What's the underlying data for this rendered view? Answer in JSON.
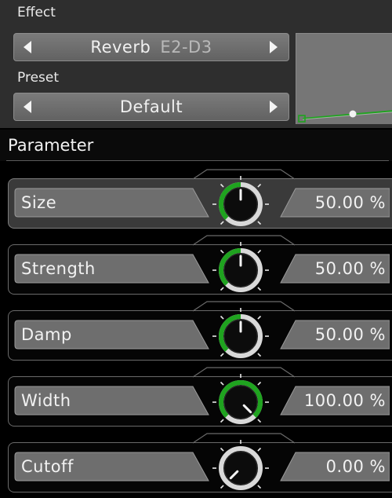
{
  "effect": {
    "label": "Effect",
    "name": "Reverb",
    "range": "E2-D3"
  },
  "preset": {
    "label": "Preset",
    "name": "Default"
  },
  "parameters": {
    "header": "Parameter",
    "items": [
      {
        "label": "Size",
        "value": "50.00 %",
        "level": 0.5,
        "active": true
      },
      {
        "label": "Strength",
        "value": "50.00 %",
        "level": 0.5,
        "active": false
      },
      {
        "label": "Damp",
        "value": "50.00 %",
        "level": 0.5,
        "active": false
      },
      {
        "label": "Width",
        "value": "100.00 %",
        "level": 1.0,
        "active": false
      },
      {
        "label": "Cutoff",
        "value": "0.00 %",
        "level": 0.0,
        "active": false
      }
    ]
  },
  "colors": {
    "accent": "#1fa31f",
    "panel": "#2e2e2e",
    "field": "#6e6e6e"
  }
}
